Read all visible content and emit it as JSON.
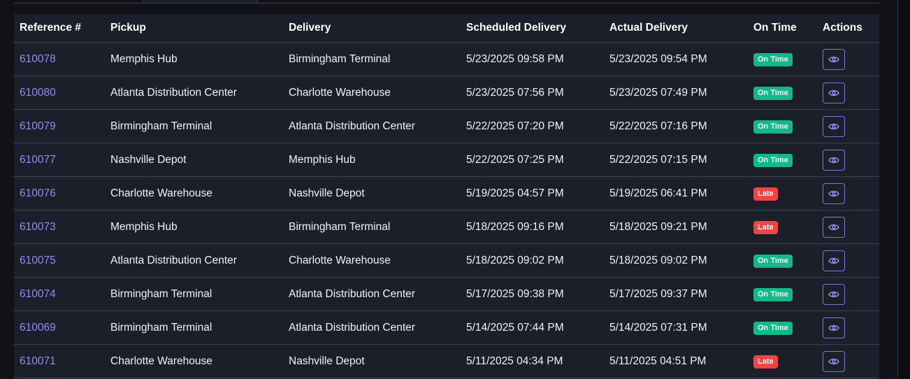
{
  "table": {
    "headers": {
      "reference": "Reference #",
      "pickup": "Pickup",
      "delivery": "Delivery",
      "scheduled": "Scheduled Delivery",
      "actual": "Actual Delivery",
      "on_time": "On Time",
      "actions": "Actions"
    },
    "rows": [
      {
        "reference": "610078",
        "pickup": "Memphis Hub",
        "delivery": "Birmingham Terminal",
        "scheduled": "5/23/2025 09:58 PM",
        "actual": "5/23/2025 09:54 PM",
        "status": "On Time"
      },
      {
        "reference": "610080",
        "pickup": "Atlanta Distribution Center",
        "delivery": "Charlotte Warehouse",
        "scheduled": "5/23/2025 07:56 PM",
        "actual": "5/23/2025 07:49 PM",
        "status": "On Time"
      },
      {
        "reference": "610079",
        "pickup": "Birmingham Terminal",
        "delivery": "Atlanta Distribution Center",
        "scheduled": "5/22/2025 07:20 PM",
        "actual": "5/22/2025 07:16 PM",
        "status": "On Time"
      },
      {
        "reference": "610077",
        "pickup": "Nashville Depot",
        "delivery": "Memphis Hub",
        "scheduled": "5/22/2025 07:25 PM",
        "actual": "5/22/2025 07:15 PM",
        "status": "On Time"
      },
      {
        "reference": "610076",
        "pickup": "Charlotte Warehouse",
        "delivery": "Nashville Depot",
        "scheduled": "5/19/2025 04:57 PM",
        "actual": "5/19/2025 06:41 PM",
        "status": "Late"
      },
      {
        "reference": "610073",
        "pickup": "Memphis Hub",
        "delivery": "Birmingham Terminal",
        "scheduled": "5/18/2025 09:16 PM",
        "actual": "5/18/2025 09:21 PM",
        "status": "Late"
      },
      {
        "reference": "610075",
        "pickup": "Atlanta Distribution Center",
        "delivery": "Charlotte Warehouse",
        "scheduled": "5/18/2025 09:02 PM",
        "actual": "5/18/2025 09:02 PM",
        "status": "On Time"
      },
      {
        "reference": "610074",
        "pickup": "Birmingham Terminal",
        "delivery": "Atlanta Distribution Center",
        "scheduled": "5/17/2025 09:38 PM",
        "actual": "5/17/2025 09:37 PM",
        "status": "On Time"
      },
      {
        "reference": "610069",
        "pickup": "Birmingham Terminal",
        "delivery": "Atlanta Distribution Center",
        "scheduled": "5/14/2025 07:44 PM",
        "actual": "5/14/2025 07:31 PM",
        "status": "On Time"
      },
      {
        "reference": "610071",
        "pickup": "Charlotte Warehouse",
        "delivery": "Nashville Depot",
        "scheduled": "5/11/2025 04:34 PM",
        "actual": "5/11/2025 04:51 PM",
        "status": "Late"
      }
    ],
    "action_icon": "eye-icon"
  },
  "colors": {
    "link": "#8f8ef4",
    "on_time": "#12b886",
    "late": "#ef4444",
    "table_bg": "#1b1f29",
    "page_bg": "#101217"
  }
}
